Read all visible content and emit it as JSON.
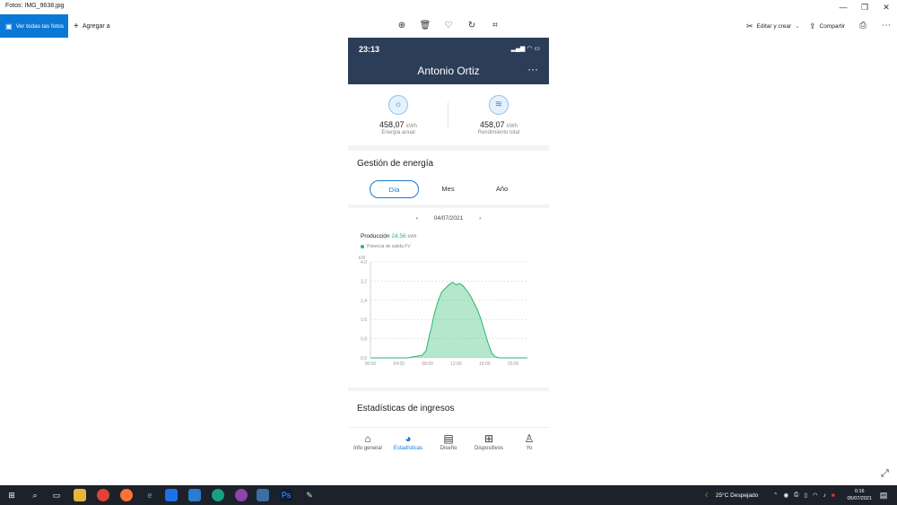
{
  "window": {
    "title": "Fotos: IMG_9638.jpg",
    "minimize": "—",
    "maximize": "❐",
    "close": "✕"
  },
  "toolbar": {
    "view_all": "Ver todas las fotos",
    "add_to": "Agregar a",
    "edit_create": "Editar y crear",
    "share": "Compartir"
  },
  "phone": {
    "status_time": "23:13",
    "user_name": "Antonio Ortiz",
    "more": "···",
    "stats": [
      {
        "value": "458,07",
        "unit": "kWh",
        "label": "Energía anual"
      },
      {
        "value": "458,07",
        "unit": "kWh",
        "label": "Rendimiento total"
      }
    ],
    "energy_title": "Gestión de energía",
    "tabs": [
      "Día",
      "Mes",
      "Año"
    ],
    "active_tab": "Día",
    "date": "04/07/2021",
    "prev": "‹",
    "next": "›",
    "production_label": "Producción",
    "production_value": "24,56",
    "production_unit": "kWh",
    "legend_label": "Potencia de salida FV",
    "income_title": "Estadísticas de ingresos",
    "nav": [
      {
        "label": "Info general",
        "icon": "home-icon"
      },
      {
        "label": "Estadísticas",
        "icon": "pie-chart-icon"
      },
      {
        "label": "Diseño",
        "icon": "layout-icon"
      },
      {
        "label": "Dispositivos",
        "icon": "devices-icon"
      },
      {
        "label": "Yo",
        "icon": "user-icon"
      }
    ]
  },
  "chart_data": {
    "type": "area",
    "ylabel": "kW",
    "ylim": [
      0,
      4.0
    ],
    "yticks": [
      "0,0",
      "0,8",
      "1,6",
      "2,4",
      "3,2",
      "4,0"
    ],
    "xticks": [
      "00:00",
      "04:00",
      "08:00",
      "12:00",
      "16:00",
      "20:00"
    ],
    "xlim": [
      0,
      22
    ],
    "series": [
      {
        "name": "Potencia de salida FV",
        "color": "#27b96b",
        "x": [
          0,
          5.2,
          6.0,
          7.2,
          7.8,
          8.3,
          8.5,
          8.7,
          9.0,
          9.5,
          10.0,
          10.5,
          11.0,
          11.5,
          12.0,
          12.5,
          13.0,
          13.5,
          14.0,
          14.5,
          15.0,
          15.5,
          16.0,
          16.5,
          17.0,
          17.5,
          18.0,
          18.5,
          19.0,
          19.5,
          20.0,
          22.0
        ],
        "y": [
          0,
          0,
          0.05,
          0.1,
          0.3,
          1.0,
          1.2,
          1.5,
          1.9,
          2.4,
          2.75,
          2.9,
          3.05,
          3.15,
          3.05,
          3.1,
          3.0,
          2.8,
          2.6,
          2.3,
          2.0,
          1.6,
          1.1,
          0.6,
          0.2,
          0.05,
          0,
          0,
          0,
          0,
          0,
          0
        ]
      }
    ],
    "grid": true
  },
  "taskbar": {
    "weather": "25°C  Despejado",
    "time": "0:16",
    "date": "05/07/2021"
  }
}
